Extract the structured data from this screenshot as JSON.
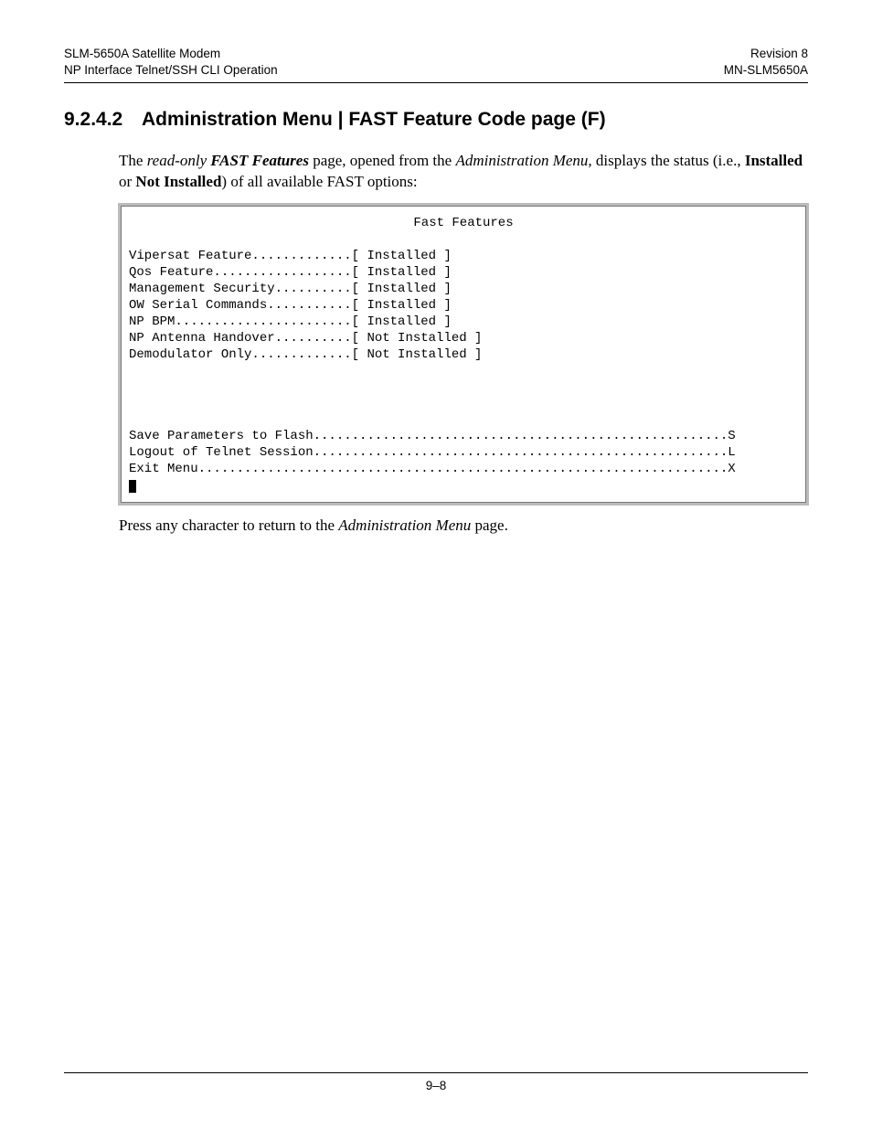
{
  "header": {
    "left_line1": "SLM-5650A Satellite Modem",
    "left_line2": "NP Interface Telnet/SSH CLI Operation",
    "right_line1": "Revision 8",
    "right_line2": "MN-SLM5650A"
  },
  "heading": {
    "number": "9.2.4.2",
    "title": "Administration Menu | FAST Feature Code page (F)"
  },
  "intro": {
    "t1": "The ",
    "t2": "read-only",
    "t3": " ",
    "t4": "FAST Features",
    "t5": " page, opened from the ",
    "t6": "Administration Menu,",
    "t7": " displays the status (i.e., ",
    "t8": "Installed",
    "t9": " or ",
    "t10": "Not Installed",
    "t11": ") of all available FAST options:"
  },
  "terminal": {
    "title": "Fast Features",
    "features": [
      "Vipersat Feature.............[ Installed ]",
      "Qos Feature..................[ Installed ]",
      "Management Security..........[ Installed ]",
      "OW Serial Commands...........[ Installed ]",
      "NP BPM.......................[ Installed ]",
      "NP Antenna Handover..........[ Not Installed ]",
      "Demodulator Only.............[ Not Installed ]"
    ],
    "actions": [
      "Save Parameters to Flash......................................................S",
      "Logout of Telnet Session......................................................L",
      "Exit Menu.....................................................................X"
    ]
  },
  "outro": {
    "t1": "Press any character to return to the ",
    "t2": "Administration Menu",
    "t3": " page."
  },
  "footer": {
    "page_number": "9–8"
  }
}
